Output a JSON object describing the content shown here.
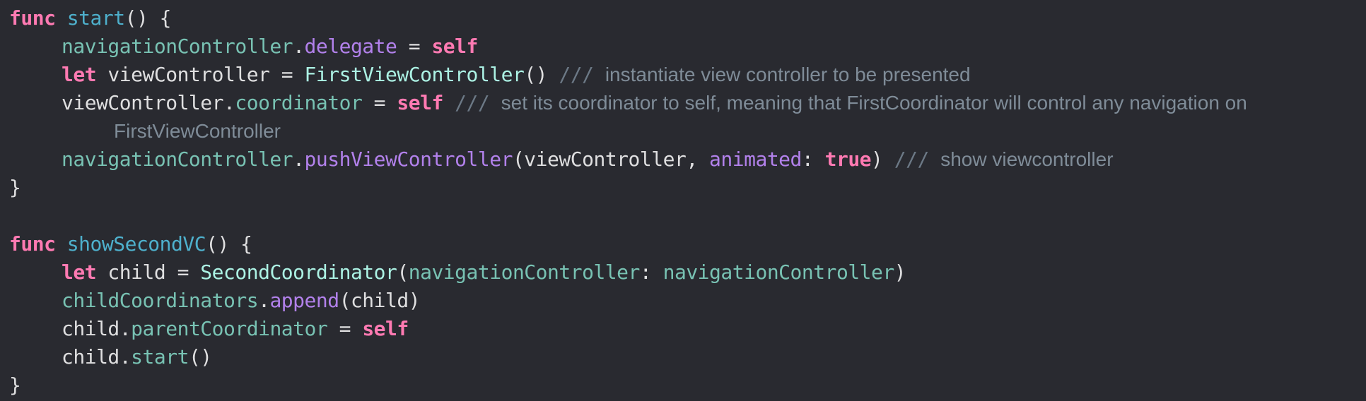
{
  "code": {
    "func1": {
      "kw": "func",
      "name": "start",
      "open": "() {",
      "l1": {
        "recv": "navigationController",
        "dot": ".",
        "prop": "delegate",
        "eq": " = ",
        "val": "self"
      },
      "l2": {
        "kw": "let",
        "name": " viewController = ",
        "type": "FirstViewController",
        "call": "()",
        "cmark": " /// ",
        "comment": "instantiate view controller to be presented"
      },
      "l3": {
        "recv": "viewController",
        "dot": ".",
        "prop": "coordinator",
        "eq": " = ",
        "val": "self",
        "cmark": " /// ",
        "comment": "set its coordinator to self, meaning that FirstCoordinator will control any navigation on",
        "comment_cont": "FirstViewController"
      },
      "l4": {
        "recv": "navigationController",
        "dot": ".",
        "method": "pushViewController",
        "open": "(viewController, ",
        "param": "animated",
        "colon": ": ",
        "val": "true",
        "close": ")",
        "cmark": " /// ",
        "comment": "show viewcontroller"
      },
      "close": "}"
    },
    "func2": {
      "kw": "func",
      "name": "showSecondVC",
      "open": "() {",
      "l1": {
        "kw": "let",
        "name": " child = ",
        "type": "SecondCoordinator",
        "open": "(",
        "param": "navigationController",
        "colon": ": ",
        "arg": "navigationController",
        "close": ")"
      },
      "l2": {
        "recv": "childCoordinators",
        "dot": ".",
        "method": "append",
        "args": "(child)"
      },
      "l3": {
        "recv": "child",
        "dot": ".",
        "prop": "parentCoordinator",
        "eq": " = ",
        "val": "self"
      },
      "l4": {
        "recv": "child",
        "dot": ".",
        "method": "start",
        "args": "()"
      },
      "close": "}"
    }
  },
  "colors": {
    "background": "#292A30",
    "keyword": "#FF7AB2",
    "declaration": "#4EB0CC",
    "property": "#78C2B3",
    "method": "#B281EB",
    "type": "#ACF2E4",
    "plain": "#DFDFE0",
    "comment": "#7F8C98"
  }
}
